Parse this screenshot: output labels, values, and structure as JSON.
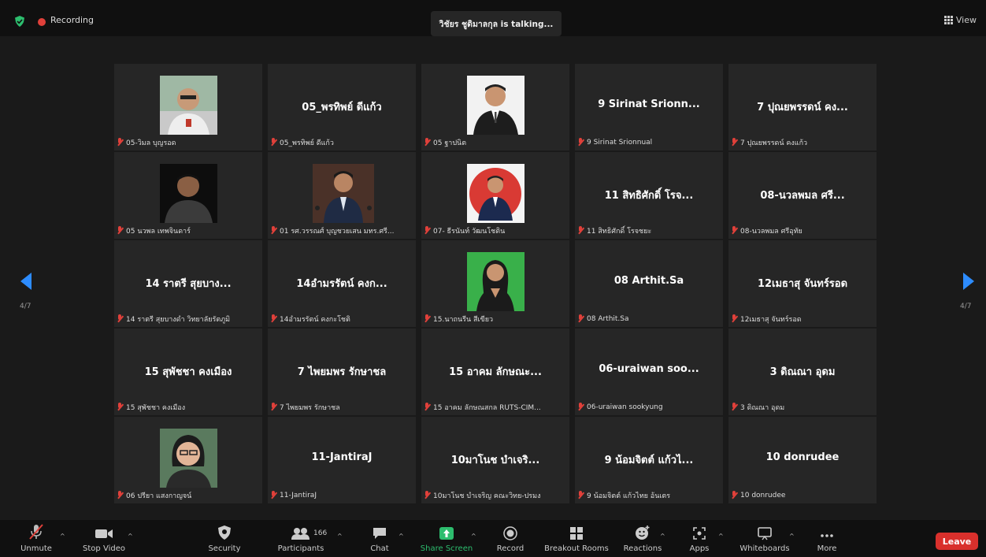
{
  "meeting": {
    "recording_label": "Recording",
    "talking_indicator": "วิชัยร ชูดิมาลกุล is talking...",
    "view_label": "View",
    "page_left": "4/7",
    "page_right": "4/7"
  },
  "tiles": [
    {
      "big": "",
      "label": "05-วิมล บุญรอด"
    },
    {
      "big": "05_พรทิพย์ ดีแก้ว",
      "label": "05_พรทิพย์ ดีแก้ว"
    },
    {
      "big": "",
      "label": "05 ฐาปนิต"
    },
    {
      "big": "9 Sirinat Srionn...",
      "label": "9 Sirinat Srionnual"
    },
    {
      "big": "7 ปุณยพรรดน์ คง...",
      "label": "7 ปุณยพรรดน์ คงแก้ว"
    },
    {
      "big": "",
      "label": "05 นวพล เทพจินดาร์"
    },
    {
      "big": "",
      "label": "01 รศ.วรรณศ์ บุญชวยเสน มทร.ศรี..."
    },
    {
      "big": "",
      "label": "07- ธีรนันท์ วัฒนโชติน"
    },
    {
      "big": "11 สิทธิศักดิ์ โรจ...",
      "label": "11 สิทธิศักดิ์ โรจชยะ"
    },
    {
      "big": "08-นวลพมล ศรี...",
      "label": "08-นวลพมล ศรีอุทัย"
    },
    {
      "big": "14 ราตรี สุยบาง...",
      "label": "14 ราตรี สุยบางดำ วิทยาลัยรัตภูมิ"
    },
    {
      "big": "14อำมรรัตน์ คงก...",
      "label": "14อำมรรัตน์ คงกะโชติ"
    },
    {
      "big": "",
      "label": "15.นาถนรีน สีเขียว"
    },
    {
      "big": "08 Arthit.Sa",
      "label": "08 Arthit.Sa"
    },
    {
      "big": "12เมธาสุ จันทร์รอด",
      "label": "12เมธาสุ จันทร์รอด"
    },
    {
      "big": "15 สุพัชชา คงเมือง",
      "label": "15 สุพัชชา คงเมือง"
    },
    {
      "big": "7 ไพยมพร รักษาชล",
      "label": "7 ไพยมพร รักษาชล"
    },
    {
      "big": "15 อาคม ลักษณะ...",
      "label": "15 อาคม ลักษณสกล RUTS-CIM..."
    },
    {
      "big": "06-uraiwan soo...",
      "label": "06-uraiwan sookyung"
    },
    {
      "big": "3 ดิณณา อุดม",
      "label": "3 ดิณณา อุดม"
    },
    {
      "big": "",
      "label": "06 ปรียา แสงกาญจน์"
    },
    {
      "big": "11-JantiraJ",
      "label": "11-JantiraJ"
    },
    {
      "big": "10มาโนช บำเจริ...",
      "label": "10มาโนช บำเจริญ คณะวิทย-ปรมง"
    },
    {
      "big": "9 น้อมจิตต์ แก้วไ...",
      "label": "9 น้อมจิตต์ แก้วไทย อ้นเตร"
    },
    {
      "big": "10 donrudee",
      "label": "10 donrudee"
    }
  ],
  "toolbar": {
    "unmute": "Unmute",
    "stop_video": "Stop Video",
    "security": "Security",
    "participants": "Participants",
    "participant_count": "166",
    "chat": "Chat",
    "share_screen": "Share Screen",
    "record": "Record",
    "breakout_rooms": "Breakout Rooms",
    "reactions": "Reactions",
    "apps": "Apps",
    "whiteboards": "Whiteboards",
    "more": "More",
    "leave": "Leave"
  },
  "colors": {
    "accent": "#2d8cff",
    "recording": "#e0403a",
    "share_screen": "#2dbd6e",
    "leave": "#d9302c"
  }
}
